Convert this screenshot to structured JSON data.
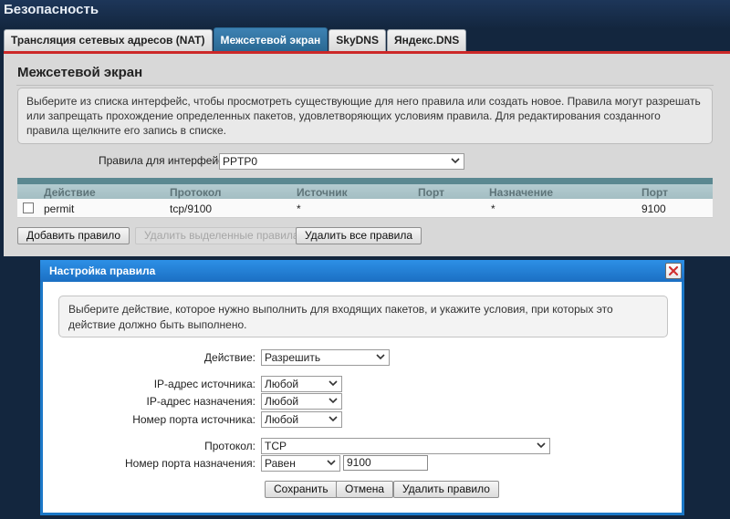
{
  "header": {
    "title": "Безопасность"
  },
  "tabs": [
    {
      "label": "Трансляция сетевых адресов (NAT)",
      "active": false
    },
    {
      "label": "Межсетевой экран",
      "active": true
    },
    {
      "label": "SkyDNS",
      "active": false
    },
    {
      "label": "Яндекс.DNS",
      "active": false
    }
  ],
  "colors": {
    "accent": "#2a6893",
    "danger": "#cc2828",
    "dialog": "#1b78c8",
    "page_bg": "#13263e"
  },
  "firewall": {
    "title": "Межсетевой экран",
    "info": "Выберите из списка интерфейс, чтобы просмотреть существующие для него правила или создать новое. Правила могут разрешать или запрещать прохождение определенных пакетов, удовлетворяющих условиям правила. Для редактирования созданного правила щелкните его запись в списке.",
    "interface_label": "Правила для интерфейса:",
    "interface_value": "PPTP0",
    "table": {
      "columns": [
        "Действие",
        "Протокол",
        "Источник",
        "Порт",
        "Назначение",
        "Порт"
      ],
      "rows": [
        {
          "action": "permit",
          "protocol": "tcp/9100",
          "source": "*",
          "source_port": "",
          "destination": "*",
          "dest_port": "9100"
        }
      ]
    },
    "buttons": {
      "add": "Добавить правило",
      "delete_selected": "Удалить выделенные правила",
      "delete_all": "Удалить все правила"
    }
  },
  "dialog": {
    "title": "Настройка правила",
    "info": "Выберите действие, которое нужно выполнить для входящих пакетов, и укажите условия, при которых это действие должно быть выполнено.",
    "fields": {
      "action": {
        "label": "Действие:",
        "value": "Разрешить"
      },
      "src_ip": {
        "label": "IP-адрес источника:",
        "value": "Любой"
      },
      "dst_ip": {
        "label": "IP-адрес назначения:",
        "value": "Любой"
      },
      "src_port": {
        "label": "Номер порта источника:",
        "value": "Любой"
      },
      "protocol": {
        "label": "Протокол:",
        "value": "TCP"
      },
      "dst_port": {
        "label": "Номер порта назначения:",
        "op": "Равен",
        "value": "9100"
      }
    },
    "buttons": {
      "save": "Сохранить",
      "cancel": "Отмена",
      "delete": "Удалить правило"
    }
  }
}
